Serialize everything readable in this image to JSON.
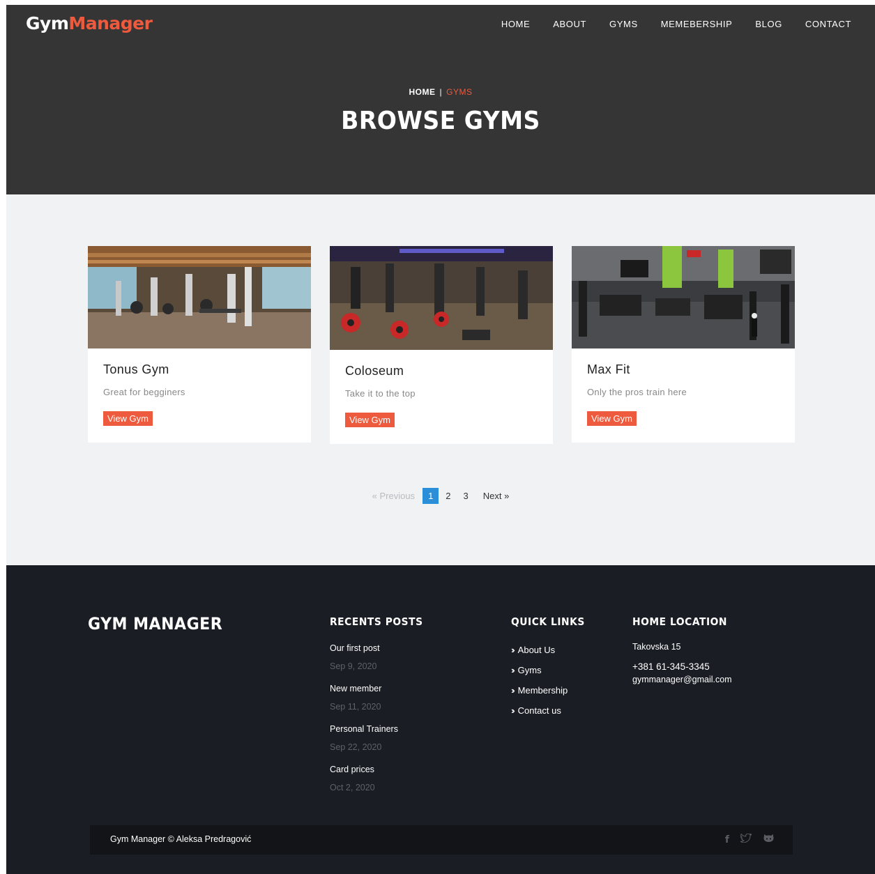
{
  "header": {
    "logo_part1": "Gym",
    "logo_part2": "Manager",
    "nav": [
      "HOME",
      "ABOUT",
      "GYMS",
      "MEMEBERSHIP",
      "BLOG",
      "CONTACT"
    ]
  },
  "hero": {
    "breadcrumb_home": "HOME",
    "breadcrumb_sep": "|",
    "breadcrumb_current": "GYMS",
    "title": "BROWSE GYMS"
  },
  "gyms": [
    {
      "name": "Tonus Gym",
      "tagline": "Great for begginers",
      "button": "View Gym"
    },
    {
      "name": "Coloseum",
      "tagline": "Take it to the top",
      "button": "View Gym"
    },
    {
      "name": "Max Fit",
      "tagline": "Only the pros train here",
      "button": "View Gym"
    }
  ],
  "pagination": {
    "previous": "« Previous",
    "pages": [
      "1",
      "2",
      "3"
    ],
    "current": "1",
    "next": "Next »"
  },
  "footer": {
    "brand": "GYM MANAGER",
    "recent_posts_title": "RECENTS POSTS",
    "posts": [
      {
        "title": "Our first post",
        "date": "Sep 9, 2020"
      },
      {
        "title": "New member",
        "date": "Sep 11, 2020"
      },
      {
        "title": "Personal Trainers",
        "date": "Sep 22, 2020"
      },
      {
        "title": "Card prices",
        "date": "Oct 2, 2020"
      }
    ],
    "quick_links_title": "QUICK LINKS",
    "quick_links": [
      "About Us",
      "Gyms",
      "Membership",
      "Contact us"
    ],
    "location_title": "HOME LOCATION",
    "address": "Takovska 15",
    "phone": "+381 61-345-3345",
    "email": "gymmanager@gmail.com",
    "copyright": "Gym Manager © Aleksa Predragović",
    "social_icons": [
      "facebook-icon",
      "twitter-icon",
      "github-icon"
    ]
  },
  "colors": {
    "accent": "#ee5a3d",
    "hero_bg": "#353535",
    "section_bg": "#f0f2f4",
    "footer_bg": "#1b1d24",
    "pagination_active": "#2a8fd8"
  }
}
